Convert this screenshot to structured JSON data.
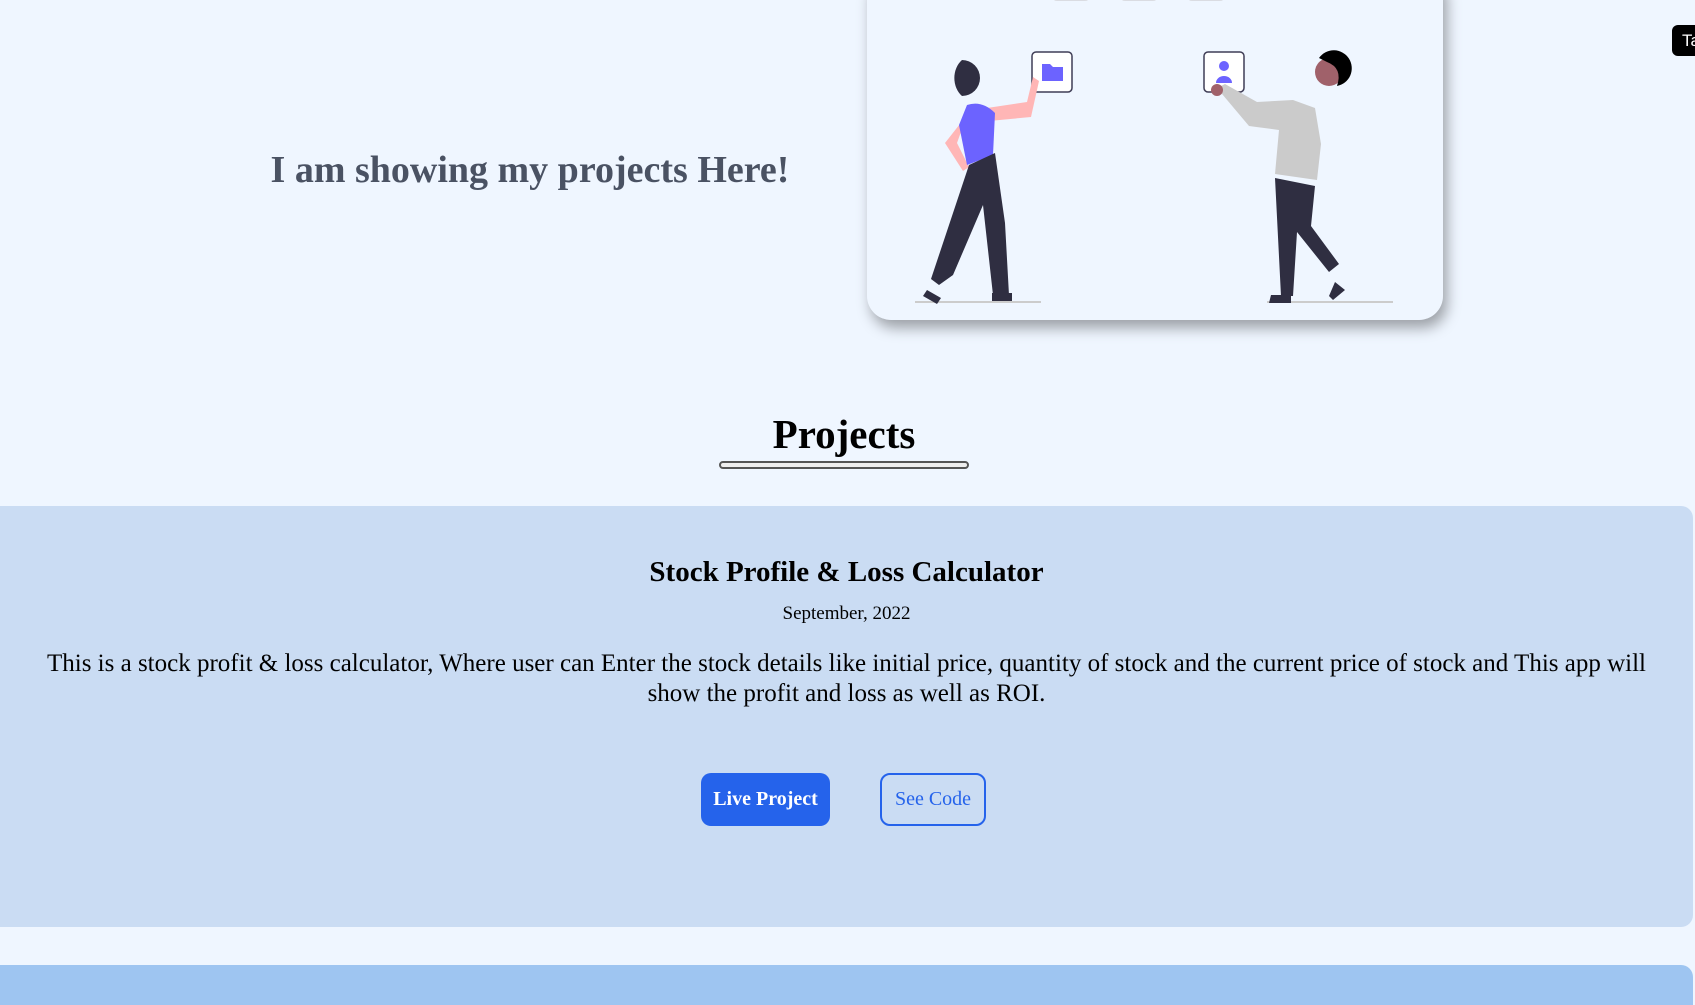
{
  "hero": {
    "heading": "I am showing my projects Here!",
    "illustration_icons": [
      "image-icon",
      "document-icon",
      "mail-icon",
      "folder-icon",
      "user-icon"
    ]
  },
  "projects_section": {
    "title": "Projects",
    "items": [
      {
        "title": "Stock Profile & Loss Calculator",
        "date": "September, 2022",
        "description": "This is a stock profit & loss calculator, Where user can Enter the stock details like initial price, quantity of stock and the current price of stock and This app will show the profit and loss as well as ROI.",
        "live_label": "Live Project",
        "code_label": "See Code"
      }
    ]
  },
  "tooltip": {
    "text": "Ta"
  },
  "colors": {
    "background": "#eff6ff",
    "card": "#cadcf3",
    "next_card": "#9ec5f1",
    "accent": "#2563eb",
    "illustration_accent": "#6c63ff"
  }
}
